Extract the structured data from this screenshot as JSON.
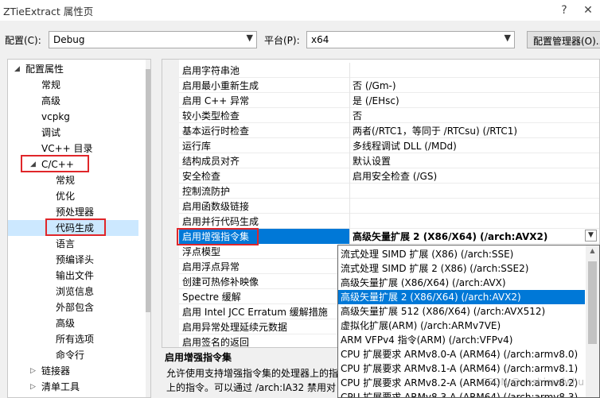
{
  "window": {
    "title": "ZTieExtract 属性页",
    "help": "?",
    "close": "✕"
  },
  "toolbar": {
    "config_label": "配置(C):",
    "config_value": "Debug",
    "platform_label": "平台(P):",
    "platform_value": "x64",
    "manager_button": "配置管理器(O)..."
  },
  "tree": [
    {
      "label": "配置属性",
      "level": 0,
      "expanded": true
    },
    {
      "label": "常规",
      "level": 1
    },
    {
      "label": "高级",
      "level": 1
    },
    {
      "label": "vcpkg",
      "level": 1
    },
    {
      "label": "调试",
      "level": 1
    },
    {
      "label": "VC++ 目录",
      "level": 1
    },
    {
      "label": "C/C++",
      "level": 1,
      "expanded": true
    },
    {
      "label": "常规",
      "level": 2
    },
    {
      "label": "优化",
      "level": 2
    },
    {
      "label": "预处理器",
      "level": 2
    },
    {
      "label": "代码生成",
      "level": 2,
      "selected": true
    },
    {
      "label": "语言",
      "level": 2
    },
    {
      "label": "预编译头",
      "level": 2
    },
    {
      "label": "输出文件",
      "level": 2
    },
    {
      "label": "浏览信息",
      "level": 2
    },
    {
      "label": "外部包含",
      "level": 2
    },
    {
      "label": "高级",
      "level": 2
    },
    {
      "label": "所有选项",
      "level": 2
    },
    {
      "label": "命令行",
      "level": 2
    },
    {
      "label": "链接器",
      "level": 1,
      "collapsed": true
    },
    {
      "label": "清单工具",
      "level": 1,
      "collapsed": true
    }
  ],
  "properties": [
    {
      "name": "启用字符串池",
      "value": ""
    },
    {
      "name": "启用最小重新生成",
      "value": "否 (/Gm-)"
    },
    {
      "name": "启用 C++ 异常",
      "value": "是 (/EHsc)"
    },
    {
      "name": "较小类型检查",
      "value": "否"
    },
    {
      "name": "基本运行时检查",
      "value": "两者(/RTC1，等同于 /RTCsu) (/RTC1)"
    },
    {
      "name": "运行库",
      "value": "多线程调试 DLL (/MDd)"
    },
    {
      "name": "结构成员对齐",
      "value": "默认设置"
    },
    {
      "name": "安全检查",
      "value": "启用安全检查 (/GS)"
    },
    {
      "name": "控制流防护",
      "value": ""
    },
    {
      "name": "启用函数级链接",
      "value": ""
    },
    {
      "name": "启用并行代码生成",
      "value": ""
    },
    {
      "name": "启用增强指令集",
      "value": "高级矢量扩展 2 (X86/X64) (/arch:AVX2)",
      "selected": true
    },
    {
      "name": "浮点模型",
      "value": ""
    },
    {
      "name": "启用浮点异常",
      "value": ""
    },
    {
      "name": "创建可热修补映像",
      "value": ""
    },
    {
      "name": "Spectre 缓解",
      "value": ""
    },
    {
      "name": "启用 Intel JCC Erratum 缓解措施",
      "value": ""
    },
    {
      "name": "启用异常处理延续元数据",
      "value": ""
    },
    {
      "name": "启用签名的返回",
      "value": ""
    }
  ],
  "dropdown": {
    "arrow": "▼",
    "options": [
      {
        "label": "流式处理 SIMD 扩展 (X86) (/arch:SSE)"
      },
      {
        "label": "流式处理 SIMD 扩展 2 (X86) (/arch:SSE2)"
      },
      {
        "label": "高级矢量扩展 (X86/X64) (/arch:AVX)"
      },
      {
        "label": "高级矢量扩展 2 (X86/X64) (/arch:AVX2)",
        "selected": true
      },
      {
        "label": "高级矢量扩展 512 (X86/X64) (/arch:AVX512)"
      },
      {
        "label": "虚拟化扩展(ARM) (/arch:ARMv7VE)"
      },
      {
        "label": "ARM VFPv4 指令(ARM) (/arch:VFPv4)"
      },
      {
        "label": "CPU 扩展要求 ARMv8.0-A (ARM64) (/arch:armv8.0)"
      },
      {
        "label": "CPU 扩展要求 ARMv8.1-A (ARM64) (/arch:armv8.1)"
      },
      {
        "label": "CPU 扩展要求 ARMv8.2-A (ARM64) (/arch:armv8.2)"
      },
      {
        "label": "CPU 扩展要求 ARMv8.3-A (ARM64) (/arch:armv8.3)"
      }
    ]
  },
  "description": {
    "title": "启用增强指令集",
    "line1": "允许使用支持增强指令集的处理器上的指",
    "line2": "上的指令。可以通过 /arch:IA32 禁用对"
  },
  "watermark": "CSDN @aoshimafwhu"
}
